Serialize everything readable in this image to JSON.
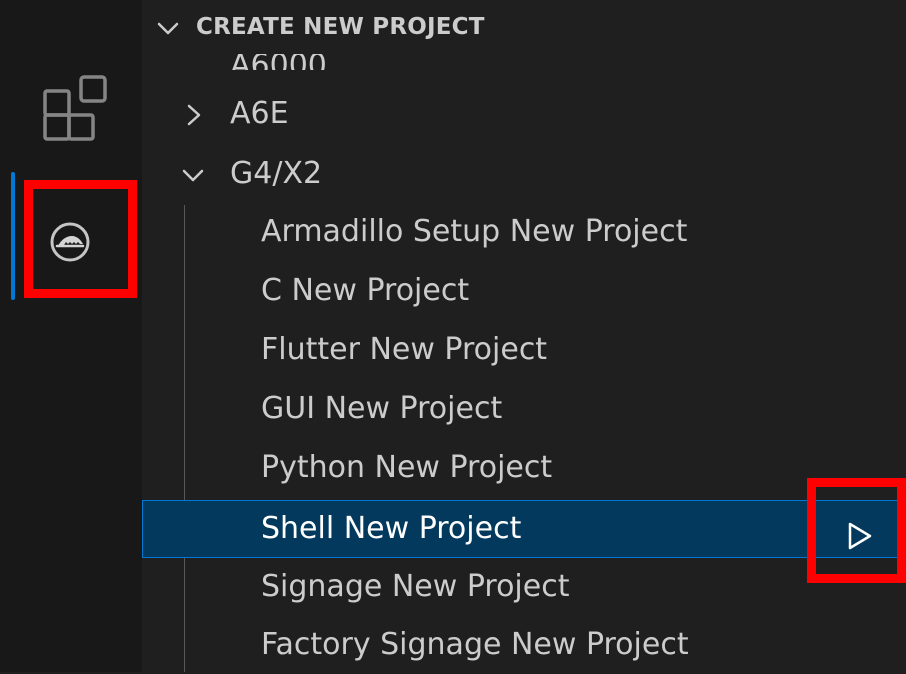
{
  "activity_bar": {
    "items": [
      {
        "name": "extensions",
        "icon": "extensions-icon",
        "active": false
      },
      {
        "name": "armadillo",
        "icon": "armadillo-icon",
        "active": true
      }
    ]
  },
  "sidebar": {
    "section": {
      "title": "CREATE NEW PROJECT",
      "expanded": true
    },
    "clipped_item": {
      "label": "A6000"
    },
    "tree": [
      {
        "label": "A6E",
        "expanded": false
      },
      {
        "label": "G4/X2",
        "expanded": true,
        "children": [
          {
            "label": "Armadillo Setup New Project"
          },
          {
            "label": "C New Project"
          },
          {
            "label": "Flutter New Project"
          },
          {
            "label": "GUI New Project"
          },
          {
            "label": "Python New Project"
          },
          {
            "label": "Shell New Project",
            "selected": true,
            "action_icon": "run-icon"
          },
          {
            "label": "Signage New Project"
          },
          {
            "label": "Factory Signage New Project"
          }
        ]
      }
    ]
  },
  "colors": {
    "background": "#1f1f1f",
    "activity_bar_background": "#181818",
    "foreground": "#cccccc",
    "selection_background": "#04395e",
    "focus_border": "#0078d4",
    "highlight_annotation": "#ff0000"
  }
}
